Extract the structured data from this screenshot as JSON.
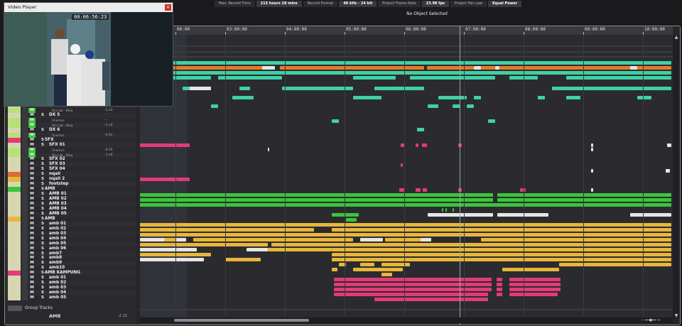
{
  "colors": {
    "teal": "#3fd1a3",
    "orange": "#e9792a",
    "white": "#e6e6e6",
    "pink": "#e33a78",
    "green": "#3ac53a",
    "yellow": "#e8b73a"
  },
  "status": {
    "max_record_time_label": "Max. Record Time",
    "max_record_time": "215 hours 28 mins",
    "record_format_label": "Record Format",
    "record_format": "48 kHz - 24 bit",
    "frame_rate_label": "Project Frame Rate",
    "frame_rate": "23.98 fps",
    "pan_law_label": "Project Pan Law",
    "pan_law": "Equal Power",
    "selection": "No Object Selected"
  },
  "video": {
    "title": "Video Player",
    "timecode": "00:06:56:23"
  },
  "ruler": {
    "ticks": [
      "00:00",
      "03:00:00",
      "04:00:00",
      "05:00:00",
      "06:00:00",
      "07:00:00",
      "08:00:00",
      "09:00:00",
      "10:00:00"
    ]
  },
  "tracks": [
    {
      "name": "DX 4",
      "color": "#d6d6b0",
      "kind": "top",
      "sub": "",
      "val": ""
    },
    {
      "name": "",
      "color": "#b8e07a",
      "kind": "sub",
      "sub": "Dia Lab - Bloq",
      "val": "-1.x0"
    },
    {
      "name": "DX 5",
      "color": "#d6d6b0",
      "kind": "top",
      "sub": "",
      "val": ""
    },
    {
      "name": "",
      "color": "#b8e07a",
      "kind": "sub",
      "sub": "Unomon",
      "val": "-·"
    },
    {
      "name": "",
      "color": "#b8e07a",
      "kind": "sub",
      "sub": "Dia Lab - Bloq",
      "val": "-1.x0"
    },
    {
      "name": "DX 6",
      "color": "#d6d6b0",
      "kind": "top",
      "sub": "",
      "val": ""
    },
    {
      "name": "",
      "color": "#b8e07a",
      "kind": "sub",
      "sub": "Unomon",
      "val": "-0.0x"
    },
    {
      "name": "SFX",
      "color": "#e33a78",
      "kind": "folder",
      "sub": "",
      "val": ""
    },
    {
      "name": "SFX 01",
      "color": "#d6d6b0",
      "kind": "top",
      "sub": "",
      "val": ""
    },
    {
      "name": "",
      "color": "#b8e07a",
      "kind": "sub",
      "sub": "Unomon",
      "val": "-0.05"
    },
    {
      "name": "",
      "color": "#b8e07a",
      "kind": "sub",
      "sub": "Dia Lab - Bloq",
      "val": "-1.x0"
    },
    {
      "name": "SFX 02",
      "color": "#d6d6b0",
      "kind": "top",
      "sub": "",
      "val": ""
    },
    {
      "name": "SFX 03",
      "color": "#d6d6b0",
      "kind": "top",
      "sub": "",
      "val": ""
    },
    {
      "name": "SFX 04",
      "color": "#d6d6b0",
      "kind": "top",
      "sub": "",
      "val": ""
    },
    {
      "name": "nqaii",
      "color": "#d86e33",
      "kind": "top",
      "sub": "",
      "val": ""
    },
    {
      "name": "nqaii 2",
      "color": "#e8b73a",
      "kind": "top",
      "sub": "",
      "val": ""
    },
    {
      "name": "footstep",
      "color": "#d6d6b0",
      "kind": "top",
      "sub": "",
      "val": ""
    },
    {
      "name": "AMB",
      "color": "#3ac53a",
      "kind": "folder",
      "sub": "",
      "val": ""
    },
    {
      "name": "AMB 01",
      "color": "#d6d6b0",
      "kind": "top",
      "sub": "",
      "val": ""
    },
    {
      "name": "AMB 02",
      "color": "#d6d6b0",
      "kind": "top",
      "sub": "",
      "val": ""
    },
    {
      "name": "AMB 03",
      "color": "#d6d6b0",
      "kind": "top",
      "sub": "",
      "val": ""
    },
    {
      "name": "AMB 04",
      "color": "#d6d6b0",
      "kind": "top",
      "sub": "",
      "val": ""
    },
    {
      "name": "AMB 05",
      "color": "#d6d6b0",
      "kind": "top",
      "sub": "",
      "val": ""
    },
    {
      "name": "AMB",
      "color": "#e8b73a",
      "kind": "folder",
      "sub": "",
      "val": ""
    },
    {
      "name": "amb 01",
      "color": "#d6d6b0",
      "kind": "top",
      "sub": "",
      "val": ""
    },
    {
      "name": "amb 02",
      "color": "#d6d6b0",
      "kind": "top",
      "sub": "",
      "val": ""
    },
    {
      "name": "amb 03",
      "color": "#d6d6b0",
      "kind": "top",
      "sub": "",
      "val": ""
    },
    {
      "name": "amb 04",
      "color": "#d6d6b0",
      "kind": "top",
      "sub": "",
      "val": ""
    },
    {
      "name": "amb 05",
      "color": "#d6d6b0",
      "kind": "top",
      "sub": "",
      "val": ""
    },
    {
      "name": "amb 06",
      "color": "#d6d6b0",
      "kind": "top",
      "sub": "",
      "val": ""
    },
    {
      "name": "amb7",
      "color": "#d6d6b0",
      "kind": "top",
      "sub": "",
      "val": ""
    },
    {
      "name": "amb8",
      "color": "#d6d6b0",
      "kind": "top",
      "sub": "",
      "val": ""
    },
    {
      "name": "amb9",
      "color": "#d6d6b0",
      "kind": "top",
      "sub": "",
      "val": ""
    },
    {
      "name": "amb10",
      "color": "#d6d6b0",
      "kind": "top",
      "sub": "",
      "val": ""
    },
    {
      "name": "AMB KAMPUNG",
      "color": "#e33a78",
      "kind": "folder",
      "sub": "",
      "val": ""
    },
    {
      "name": "amb 01",
      "color": "#d6d6b0",
      "kind": "top",
      "sub": "",
      "val": ""
    },
    {
      "name": "amb 02",
      "color": "#d6d6b0",
      "kind": "top",
      "sub": "",
      "val": ""
    },
    {
      "name": "amb 03",
      "color": "#d6d6b0",
      "kind": "top",
      "sub": "",
      "val": ""
    },
    {
      "name": "amb 04",
      "color": "#d6d6b0",
      "kind": "top",
      "sub": "",
      "val": ""
    },
    {
      "name": "amb 05",
      "color": "#d6d6b0",
      "kind": "top",
      "sub": "",
      "val": ""
    }
  ],
  "group_tracks_label": "Group Tracks",
  "bottom_track": {
    "name": "AMB",
    "val": "-2.12"
  }
}
